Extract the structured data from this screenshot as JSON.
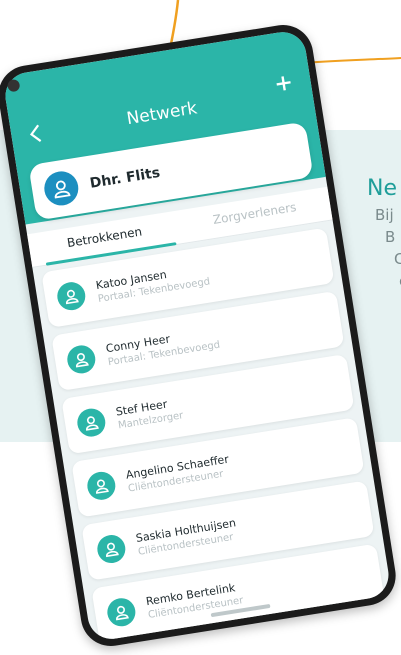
{
  "app": {
    "title": "Netwerk",
    "back_icon": "chevron-left-icon",
    "add_icon": "plus-icon",
    "accent": "#2bb5a8",
    "callout": "#f0a020"
  },
  "client": {
    "name": "Dhr. Flits",
    "avatar_icon": "person-icon"
  },
  "tabs": [
    {
      "label": "Betrokkenen",
      "active": true
    },
    {
      "label": "Zorgverleners",
      "active": false
    }
  ],
  "contacts": [
    {
      "name": "Katoo Jansen",
      "role": "Portaal: Tekenbevoegd"
    },
    {
      "name": "Conny Heer",
      "role": "Portaal: Tekenbevoegd"
    },
    {
      "name": "Stef Heer",
      "role": "Mantelzorger"
    },
    {
      "name": "Angelino Schaeffer",
      "role": "Cliëntondersteuner"
    },
    {
      "name": "Saskia Holthuijsen",
      "role": "Cliëntondersteuner"
    },
    {
      "name": "Remko Bertelink",
      "role": "Cliëntondersteuner"
    }
  ],
  "side_text": [
    "Ne",
    "Bij",
    "B",
    "C",
    "c"
  ]
}
